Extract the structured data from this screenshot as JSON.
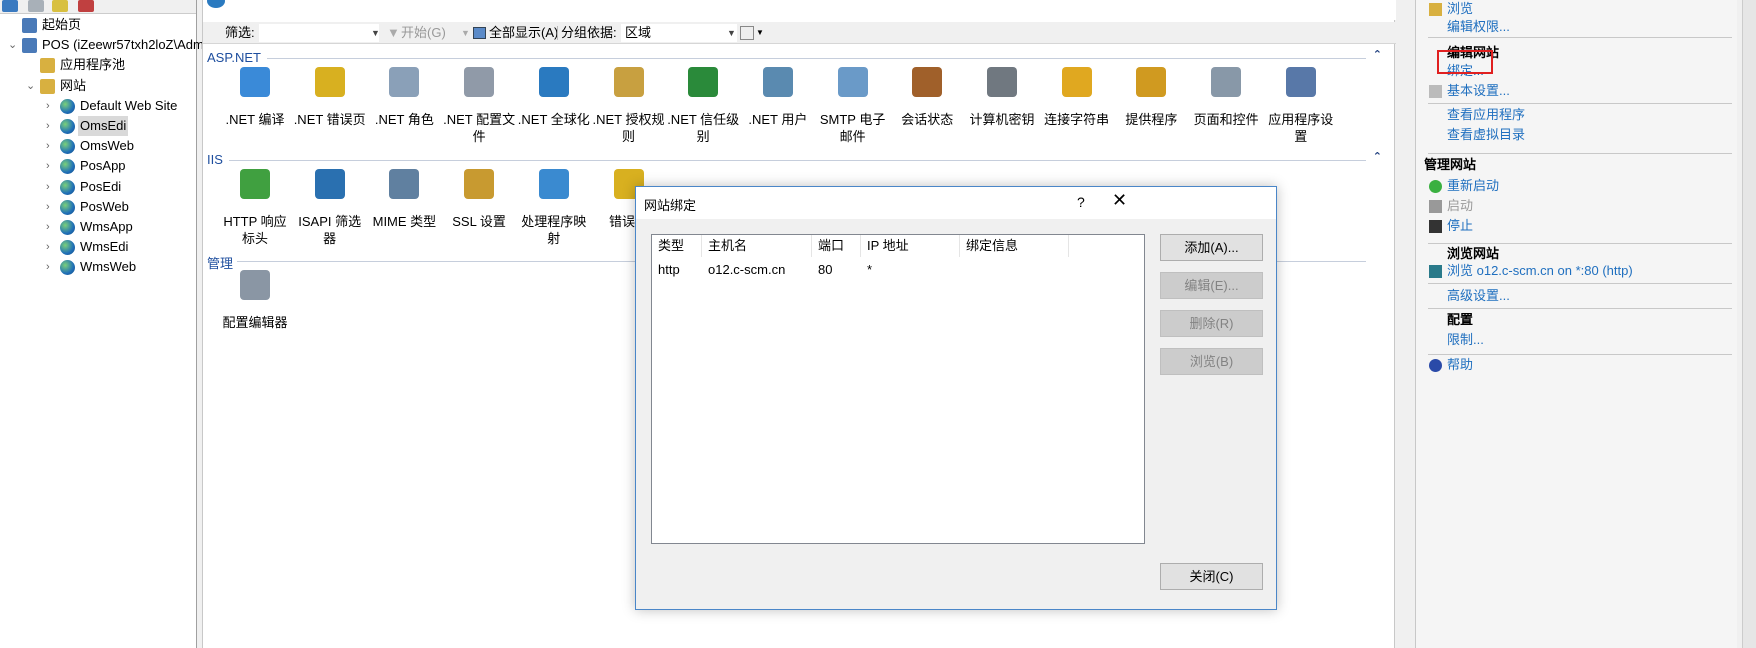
{
  "tree": {
    "items": [
      {
        "label": "起始页",
        "level": 0,
        "icon": "start-page-icon",
        "chevron": ""
      },
      {
        "label": "POS (iZeewr57txh2loZ\\Adm",
        "level": 0,
        "icon": "server-icon",
        "chevron": "expanded"
      },
      {
        "label": "应用程序池",
        "level": 1,
        "icon": "app-pool-icon",
        "chevron": ""
      },
      {
        "label": "网站",
        "level": 1,
        "icon": "sites-folder-icon",
        "chevron": "expanded"
      },
      {
        "label": "Default Web Site",
        "level": 2,
        "icon": "globe-stopped-icon",
        "chevron": "collapsed"
      },
      {
        "label": "OmsEdi",
        "level": 2,
        "icon": "globe-icon",
        "chevron": "collapsed",
        "selected": true
      },
      {
        "label": "OmsWeb",
        "level": 2,
        "icon": "globe-icon",
        "chevron": "collapsed"
      },
      {
        "label": "PosApp",
        "level": 2,
        "icon": "globe-icon",
        "chevron": "collapsed"
      },
      {
        "label": "PosEdi",
        "level": 2,
        "icon": "globe-icon",
        "chevron": "collapsed"
      },
      {
        "label": "PosWeb",
        "level": 2,
        "icon": "globe-icon",
        "chevron": "collapsed"
      },
      {
        "label": "WmsApp",
        "level": 2,
        "icon": "globe-icon",
        "chevron": "collapsed"
      },
      {
        "label": "WmsEdi",
        "level": 2,
        "icon": "globe-icon",
        "chevron": "collapsed"
      },
      {
        "label": "WmsWeb",
        "level": 2,
        "icon": "globe-icon",
        "chevron": "collapsed"
      }
    ]
  },
  "toolbar": {
    "filter_label": "筛选:",
    "filter_value": "",
    "start_label": "开始(G)",
    "show_all_label": "全部显示(A)",
    "group_by_label": "分组依据:",
    "group_by_value": "区域"
  },
  "groups": [
    {
      "title": "ASP.NET",
      "features": [
        {
          "label": ".NET 编译",
          "icon": "net-compile-icon",
          "color": "#3a8ad8"
        },
        {
          "label": ".NET 错误页",
          "icon": "error-page-404-icon",
          "color": "#d8b020"
        },
        {
          "label": ".NET 角色",
          "icon": "roles-icon",
          "color": "#8aa0b8"
        },
        {
          "label": ".NET 配置文件",
          "icon": "profile-icon",
          "color": "#909aa8"
        },
        {
          "label": ".NET 全球化",
          "icon": "globe-icon",
          "color": "#2a7ac0"
        },
        {
          "label": ".NET 授权规则",
          "icon": "lock-rules-icon",
          "color": "#c8a040"
        },
        {
          "label": ".NET 信任级别",
          "icon": "trust-level-icon",
          "color": "#2a8a3a"
        },
        {
          "label": ".NET 用户",
          "icon": "users-icon",
          "color": "#5a8ab0"
        },
        {
          "label": "SMTP 电子邮件",
          "icon": "email-icon",
          "color": "#6a9ac8"
        },
        {
          "label": "会话状态",
          "icon": "session-state-icon",
          "color": "#a0602a"
        },
        {
          "label": "计算机密钥",
          "icon": "machine-key-icon",
          "color": "#707880"
        },
        {
          "label": "连接字符串",
          "icon": "connection-string-icon",
          "color": "#e0a820"
        },
        {
          "label": "提供程序",
          "icon": "providers-icon",
          "color": "#d09a20"
        },
        {
          "label": "页面和控件",
          "icon": "pages-controls-icon",
          "color": "#8898a8"
        },
        {
          "label": "应用程序设置",
          "icon": "app-settings-icon",
          "color": "#5878a8"
        }
      ]
    },
    {
      "title": "IIS",
      "features": [
        {
          "label": "HTTP 响应标头",
          "icon": "http-headers-icon",
          "color": "#40a040"
        },
        {
          "label": "ISAPI 筛选器",
          "icon": "isapi-filter-icon",
          "color": "#2a70b0"
        },
        {
          "label": "MIME 类型",
          "icon": "mime-types-icon",
          "color": "#6080a0"
        },
        {
          "label": "SSL 设置",
          "icon": "ssl-lock-icon",
          "color": "#c89a30"
        },
        {
          "label": "处理程序映射",
          "icon": "handler-mappings-icon",
          "color": "#3a8ad0"
        },
        {
          "label": "错误页",
          "icon": "error-page-404-icon",
          "color": "#d8b020"
        }
      ]
    },
    {
      "title": "管理",
      "features": [
        {
          "label": "配置编辑器",
          "icon": "config-editor-icon",
          "color": "#8a96a4"
        }
      ]
    }
  ],
  "actions": {
    "items": [
      {
        "type": "link",
        "label": "浏览",
        "icon": "explore-icon"
      },
      {
        "type": "link",
        "label": "编辑权限..."
      },
      {
        "type": "sep"
      },
      {
        "type": "header",
        "label": "编辑网站"
      },
      {
        "type": "link",
        "label": "绑定...",
        "highlight": true
      },
      {
        "type": "link",
        "label": "基本设置...",
        "icon": "settings-icon"
      },
      {
        "type": "sep"
      },
      {
        "type": "link",
        "label": "查看应用程序"
      },
      {
        "type": "link",
        "label": "查看虚拟目录"
      },
      {
        "type": "sep"
      },
      {
        "type": "section",
        "label": "管理网站"
      },
      {
        "type": "link",
        "label": "重新启动",
        "icon": "restart-icon"
      },
      {
        "type": "link",
        "label": "启动",
        "icon": "start-icon",
        "disabled": true
      },
      {
        "type": "link",
        "label": "停止",
        "icon": "stop-icon"
      },
      {
        "type": "sep"
      },
      {
        "type": "header",
        "label": "浏览网站"
      },
      {
        "type": "link",
        "label": "浏览 o12.c-scm.cn on *:80 (http)",
        "icon": "browse-site-icon"
      },
      {
        "type": "sep"
      },
      {
        "type": "link",
        "label": "高级设置..."
      },
      {
        "type": "sep"
      },
      {
        "type": "header",
        "label": "配置"
      },
      {
        "type": "link",
        "label": "限制..."
      },
      {
        "type": "sep"
      },
      {
        "type": "link",
        "label": "帮助",
        "icon": "help-icon"
      }
    ],
    "highlight_color": "#e02020"
  },
  "dialog": {
    "title": "网站绑定",
    "help_label": "?",
    "columns": [
      "类型",
      "主机名",
      "端口",
      "IP 地址",
      "绑定信息"
    ],
    "rows": [
      [
        "http",
        "o12.c-scm.cn",
        "80",
        "*",
        ""
      ]
    ],
    "buttons": {
      "add": "添加(A)...",
      "edit": "编辑(E)...",
      "remove": "删除(R)",
      "browse": "浏览(B)",
      "close": "关闭(C)"
    }
  }
}
